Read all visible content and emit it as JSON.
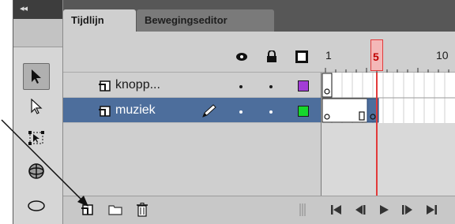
{
  "tools_panel": {
    "collapse_label": "◂◂"
  },
  "tabs": [
    {
      "label": "Tijdlijn",
      "active": true
    },
    {
      "label": "Bewegingseditor",
      "active": false
    }
  ],
  "header": {
    "icons": [
      "eye-icon",
      "lock-icon",
      "outline-square-icon"
    ],
    "ruler_labels": [
      "1",
      "5",
      "10"
    ],
    "current_frame": "5"
  },
  "layers": [
    {
      "name": "knopp...",
      "color": "#a23cd6",
      "selected": false,
      "icon": "layer-icon"
    },
    {
      "name": "muziek",
      "color": "#16d62c",
      "selected": true,
      "icon": "layer-icon",
      "editing_icon": "pencil-icon"
    }
  ],
  "bottom_toolbar": {
    "icons": [
      "new-layer-icon",
      "new-folder-icon",
      "delete-layer-icon"
    ],
    "playback_icons": [
      "go-to-first-frame-icon",
      "step-back-icon",
      "play-icon",
      "step-forward-icon",
      "go-to-last-frame-icon"
    ]
  },
  "colors": {
    "tab_bar": "#575757",
    "panel_bg": "#cfcfcf",
    "selected_row": "#4d6e9c",
    "playhead": "#e23a3a"
  }
}
